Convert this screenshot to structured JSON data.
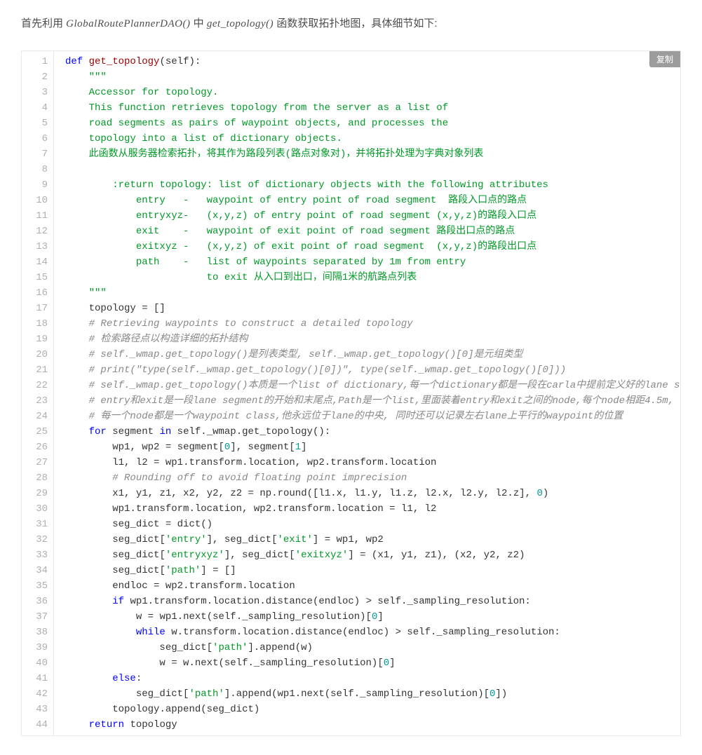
{
  "intro": {
    "prefix": "首先利用 ",
    "class_name": "GlobalRoutePlannerDAO()",
    "middle": " 中 ",
    "func_name": "get_topology()",
    "suffix": " 函数获取拓扑地图，具体细节如下:"
  },
  "copy_label": "复制",
  "code_lines": [
    [
      [
        "kw",
        "def"
      ],
      [
        "pun",
        " "
      ],
      [
        "fn",
        "get_topology"
      ],
      [
        "pun",
        "("
      ],
      [
        "nm",
        "self"
      ],
      [
        "pun",
        "):"
      ]
    ],
    [
      [
        "pun",
        "    "
      ],
      [
        "docstr",
        "\"\"\""
      ]
    ],
    [
      [
        "docstr",
        "    Accessor for topology."
      ]
    ],
    [
      [
        "docstr",
        "    This function retrieves topology from the server as a list of"
      ]
    ],
    [
      [
        "docstr",
        "    road segments as pairs of waypoint objects, and processes the"
      ]
    ],
    [
      [
        "docstr",
        "    topology into a list of dictionary objects."
      ]
    ],
    [
      [
        "docstr",
        "    此函数从服务器检索拓扑，将其作为路段列表(路点对象对)，并将拓扑处理为字典对象列表"
      ]
    ],
    [
      [
        "pun",
        ""
      ]
    ],
    [
      [
        "docstr",
        "        :return topology: list of dictionary objects with the following attributes"
      ]
    ],
    [
      [
        "docstr",
        "            entry   -   waypoint of entry point of road segment  路段入口点的路点"
      ]
    ],
    [
      [
        "docstr",
        "            entryxyz-   (x,y,z) of entry point of road segment (x,y,z)的路段入口点"
      ]
    ],
    [
      [
        "docstr",
        "            exit    -   waypoint of exit point of road segment 路段出口点的路点"
      ]
    ],
    [
      [
        "docstr",
        "            exitxyz -   (x,y,z) of exit point of road segment  (x,y,z)的路段出口点"
      ]
    ],
    [
      [
        "docstr",
        "            path    -   list of waypoints separated by 1m from entry"
      ]
    ],
    [
      [
        "docstr",
        "                        to exit 从入口到出口，间隔1米的航路点列表"
      ]
    ],
    [
      [
        "pun",
        "    "
      ],
      [
        "docstr",
        "\"\"\""
      ]
    ],
    [
      [
        "pun",
        "    "
      ],
      [
        "nm",
        "topology"
      ],
      [
        "pun",
        " = []"
      ]
    ],
    [
      [
        "pun",
        "    "
      ],
      [
        "cmt",
        "# Retrieving waypoints to construct a detailed topology"
      ]
    ],
    [
      [
        "pun",
        "    "
      ],
      [
        "cmt",
        "# 检索路径点以构造详细的拓扑结构"
      ]
    ],
    [
      [
        "pun",
        "    "
      ],
      [
        "cmt",
        "# self._wmap.get_topology()是列表类型, self._wmap.get_topology()[0]是元组类型"
      ]
    ],
    [
      [
        "pun",
        "    "
      ],
      [
        "cmt",
        "# print(\"type(self._wmap.get_topology()[0])\", type(self._wmap.get_topology()[0]))"
      ]
    ],
    [
      [
        "pun",
        "    "
      ],
      [
        "cmt",
        "# self._wmap.get_topology()本质是一个list of dictionary,每一个dictionary都是一段在carla中提前定义好的lane seg"
      ]
    ],
    [
      [
        "pun",
        "    "
      ],
      [
        "cmt",
        "# entry和exit是一段lane segment的开始和末尾点,Path是一个list,里面装着entry和exit之间的node,每个node相距4.5m,"
      ]
    ],
    [
      [
        "pun",
        "    "
      ],
      [
        "cmt",
        "# 每一个node都是一个waypoint class,他永远位于lane的中央, 同时还可以记录左右lane上平行的waypoint的位置"
      ]
    ],
    [
      [
        "pun",
        "    "
      ],
      [
        "kw",
        "for"
      ],
      [
        "pun",
        " "
      ],
      [
        "nm",
        "segment"
      ],
      [
        "pun",
        " "
      ],
      [
        "kw",
        "in"
      ],
      [
        "pun",
        " "
      ],
      [
        "nm",
        "self"
      ],
      [
        "pun",
        "."
      ],
      [
        "nm",
        "_wmap"
      ],
      [
        "pun",
        "."
      ],
      [
        "nm",
        "get_topology"
      ],
      [
        "pun",
        "():"
      ]
    ],
    [
      [
        "pun",
        "        "
      ],
      [
        "nm",
        "wp1"
      ],
      [
        "pun",
        ", "
      ],
      [
        "nm",
        "wp2"
      ],
      [
        "pun",
        " = "
      ],
      [
        "nm",
        "segment"
      ],
      [
        "pun",
        "["
      ],
      [
        "num",
        "0"
      ],
      [
        "pun",
        "], "
      ],
      [
        "nm",
        "segment"
      ],
      [
        "pun",
        "["
      ],
      [
        "num",
        "1"
      ],
      [
        "pun",
        "]"
      ]
    ],
    [
      [
        "pun",
        "        "
      ],
      [
        "nm",
        "l1"
      ],
      [
        "pun",
        ", "
      ],
      [
        "nm",
        "l2"
      ],
      [
        "pun",
        " = "
      ],
      [
        "nm",
        "wp1"
      ],
      [
        "pun",
        "."
      ],
      [
        "nm",
        "transform"
      ],
      [
        "pun",
        "."
      ],
      [
        "nm",
        "location"
      ],
      [
        "pun",
        ", "
      ],
      [
        "nm",
        "wp2"
      ],
      [
        "pun",
        "."
      ],
      [
        "nm",
        "transform"
      ],
      [
        "pun",
        "."
      ],
      [
        "nm",
        "location"
      ]
    ],
    [
      [
        "pun",
        "        "
      ],
      [
        "cmt",
        "# Rounding off to avoid floating point imprecision"
      ]
    ],
    [
      [
        "pun",
        "        "
      ],
      [
        "nm",
        "x1"
      ],
      [
        "pun",
        ", "
      ],
      [
        "nm",
        "y1"
      ],
      [
        "pun",
        ", "
      ],
      [
        "nm",
        "z1"
      ],
      [
        "pun",
        ", "
      ],
      [
        "nm",
        "x2"
      ],
      [
        "pun",
        ", "
      ],
      [
        "nm",
        "y2"
      ],
      [
        "pun",
        ", "
      ],
      [
        "nm",
        "z2"
      ],
      [
        "pun",
        " = "
      ],
      [
        "nm",
        "np"
      ],
      [
        "pun",
        "."
      ],
      [
        "nm",
        "round"
      ],
      [
        "pun",
        "(["
      ],
      [
        "nm",
        "l1"
      ],
      [
        "pun",
        "."
      ],
      [
        "nm",
        "x"
      ],
      [
        "pun",
        ", "
      ],
      [
        "nm",
        "l1"
      ],
      [
        "pun",
        "."
      ],
      [
        "nm",
        "y"
      ],
      [
        "pun",
        ", "
      ],
      [
        "nm",
        "l1"
      ],
      [
        "pun",
        "."
      ],
      [
        "nm",
        "z"
      ],
      [
        "pun",
        ", "
      ],
      [
        "nm",
        "l2"
      ],
      [
        "pun",
        "."
      ],
      [
        "nm",
        "x"
      ],
      [
        "pun",
        ", "
      ],
      [
        "nm",
        "l2"
      ],
      [
        "pun",
        "."
      ],
      [
        "nm",
        "y"
      ],
      [
        "pun",
        ", "
      ],
      [
        "nm",
        "l2"
      ],
      [
        "pun",
        "."
      ],
      [
        "nm",
        "z"
      ],
      [
        "pun",
        "], "
      ],
      [
        "num",
        "0"
      ],
      [
        "pun",
        ")"
      ]
    ],
    [
      [
        "pun",
        "        "
      ],
      [
        "nm",
        "wp1"
      ],
      [
        "pun",
        "."
      ],
      [
        "nm",
        "transform"
      ],
      [
        "pun",
        "."
      ],
      [
        "nm",
        "location"
      ],
      [
        "pun",
        ", "
      ],
      [
        "nm",
        "wp2"
      ],
      [
        "pun",
        "."
      ],
      [
        "nm",
        "transform"
      ],
      [
        "pun",
        "."
      ],
      [
        "nm",
        "location"
      ],
      [
        "pun",
        " = "
      ],
      [
        "nm",
        "l1"
      ],
      [
        "pun",
        ", "
      ],
      [
        "nm",
        "l2"
      ]
    ],
    [
      [
        "pun",
        "        "
      ],
      [
        "nm",
        "seg_dict"
      ],
      [
        "pun",
        " = "
      ],
      [
        "nm",
        "dict"
      ],
      [
        "pun",
        "()"
      ]
    ],
    [
      [
        "pun",
        "        "
      ],
      [
        "nm",
        "seg_dict"
      ],
      [
        "pun",
        "["
      ],
      [
        "str",
        "'entry'"
      ],
      [
        "pun",
        "], "
      ],
      [
        "nm",
        "seg_dict"
      ],
      [
        "pun",
        "["
      ],
      [
        "str",
        "'exit'"
      ],
      [
        "pun",
        "] = "
      ],
      [
        "nm",
        "wp1"
      ],
      [
        "pun",
        ", "
      ],
      [
        "nm",
        "wp2"
      ]
    ],
    [
      [
        "pun",
        "        "
      ],
      [
        "nm",
        "seg_dict"
      ],
      [
        "pun",
        "["
      ],
      [
        "str",
        "'entryxyz'"
      ],
      [
        "pun",
        "], "
      ],
      [
        "nm",
        "seg_dict"
      ],
      [
        "pun",
        "["
      ],
      [
        "str",
        "'exitxyz'"
      ],
      [
        "pun",
        "] = ("
      ],
      [
        "nm",
        "x1"
      ],
      [
        "pun",
        ", "
      ],
      [
        "nm",
        "y1"
      ],
      [
        "pun",
        ", "
      ],
      [
        "nm",
        "z1"
      ],
      [
        "pun",
        "), ("
      ],
      [
        "nm",
        "x2"
      ],
      [
        "pun",
        ", "
      ],
      [
        "nm",
        "y2"
      ],
      [
        "pun",
        ", "
      ],
      [
        "nm",
        "z2"
      ],
      [
        "pun",
        ")"
      ]
    ],
    [
      [
        "pun",
        "        "
      ],
      [
        "nm",
        "seg_dict"
      ],
      [
        "pun",
        "["
      ],
      [
        "str",
        "'path'"
      ],
      [
        "pun",
        "] = []"
      ]
    ],
    [
      [
        "pun",
        "        "
      ],
      [
        "nm",
        "endloc"
      ],
      [
        "pun",
        " = "
      ],
      [
        "nm",
        "wp2"
      ],
      [
        "pun",
        "."
      ],
      [
        "nm",
        "transform"
      ],
      [
        "pun",
        "."
      ],
      [
        "nm",
        "location"
      ]
    ],
    [
      [
        "pun",
        "        "
      ],
      [
        "kw",
        "if"
      ],
      [
        "pun",
        " "
      ],
      [
        "nm",
        "wp1"
      ],
      [
        "pun",
        "."
      ],
      [
        "nm",
        "transform"
      ],
      [
        "pun",
        "."
      ],
      [
        "nm",
        "location"
      ],
      [
        "pun",
        "."
      ],
      [
        "nm",
        "distance"
      ],
      [
        "pun",
        "("
      ],
      [
        "nm",
        "endloc"
      ],
      [
        "pun",
        ") > "
      ],
      [
        "nm",
        "self"
      ],
      [
        "pun",
        "."
      ],
      [
        "nm",
        "_sampling_resolution"
      ],
      [
        "pun",
        ":"
      ]
    ],
    [
      [
        "pun",
        "            "
      ],
      [
        "nm",
        "w"
      ],
      [
        "pun",
        " = "
      ],
      [
        "nm",
        "wp1"
      ],
      [
        "pun",
        "."
      ],
      [
        "nm",
        "next"
      ],
      [
        "pun",
        "("
      ],
      [
        "nm",
        "self"
      ],
      [
        "pun",
        "."
      ],
      [
        "nm",
        "_sampling_resolution"
      ],
      [
        "pun",
        ")["
      ],
      [
        "num",
        "0"
      ],
      [
        "pun",
        "]"
      ]
    ],
    [
      [
        "pun",
        "            "
      ],
      [
        "kw",
        "while"
      ],
      [
        "pun",
        " "
      ],
      [
        "nm",
        "w"
      ],
      [
        "pun",
        "."
      ],
      [
        "nm",
        "transform"
      ],
      [
        "pun",
        "."
      ],
      [
        "nm",
        "location"
      ],
      [
        "pun",
        "."
      ],
      [
        "nm",
        "distance"
      ],
      [
        "pun",
        "("
      ],
      [
        "nm",
        "endloc"
      ],
      [
        "pun",
        ") > "
      ],
      [
        "nm",
        "self"
      ],
      [
        "pun",
        "."
      ],
      [
        "nm",
        "_sampling_resolution"
      ],
      [
        "pun",
        ":"
      ]
    ],
    [
      [
        "pun",
        "                "
      ],
      [
        "nm",
        "seg_dict"
      ],
      [
        "pun",
        "["
      ],
      [
        "str",
        "'path'"
      ],
      [
        "pun",
        "]."
      ],
      [
        "nm",
        "append"
      ],
      [
        "pun",
        "("
      ],
      [
        "nm",
        "w"
      ],
      [
        "pun",
        ")"
      ]
    ],
    [
      [
        "pun",
        "                "
      ],
      [
        "nm",
        "w"
      ],
      [
        "pun",
        " = "
      ],
      [
        "nm",
        "w"
      ],
      [
        "pun",
        "."
      ],
      [
        "nm",
        "next"
      ],
      [
        "pun",
        "("
      ],
      [
        "nm",
        "self"
      ],
      [
        "pun",
        "."
      ],
      [
        "nm",
        "_sampling_resolution"
      ],
      [
        "pun",
        ")["
      ],
      [
        "num",
        "0"
      ],
      [
        "pun",
        "]"
      ]
    ],
    [
      [
        "pun",
        "        "
      ],
      [
        "kw",
        "else"
      ],
      [
        "pun",
        ":"
      ]
    ],
    [
      [
        "pun",
        "            "
      ],
      [
        "nm",
        "seg_dict"
      ],
      [
        "pun",
        "["
      ],
      [
        "str",
        "'path'"
      ],
      [
        "pun",
        "]."
      ],
      [
        "nm",
        "append"
      ],
      [
        "pun",
        "("
      ],
      [
        "nm",
        "wp1"
      ],
      [
        "pun",
        "."
      ],
      [
        "nm",
        "next"
      ],
      [
        "pun",
        "("
      ],
      [
        "nm",
        "self"
      ],
      [
        "pun",
        "."
      ],
      [
        "nm",
        "_sampling_resolution"
      ],
      [
        "pun",
        ")["
      ],
      [
        "num",
        "0"
      ],
      [
        "pun",
        "])"
      ]
    ],
    [
      [
        "pun",
        "        "
      ],
      [
        "nm",
        "topology"
      ],
      [
        "pun",
        "."
      ],
      [
        "nm",
        "append"
      ],
      [
        "pun",
        "("
      ],
      [
        "nm",
        "seg_dict"
      ],
      [
        "pun",
        ")"
      ]
    ],
    [
      [
        "pun",
        "    "
      ],
      [
        "kw",
        "return"
      ],
      [
        "pun",
        " "
      ],
      [
        "nm",
        "topology"
      ]
    ]
  ]
}
